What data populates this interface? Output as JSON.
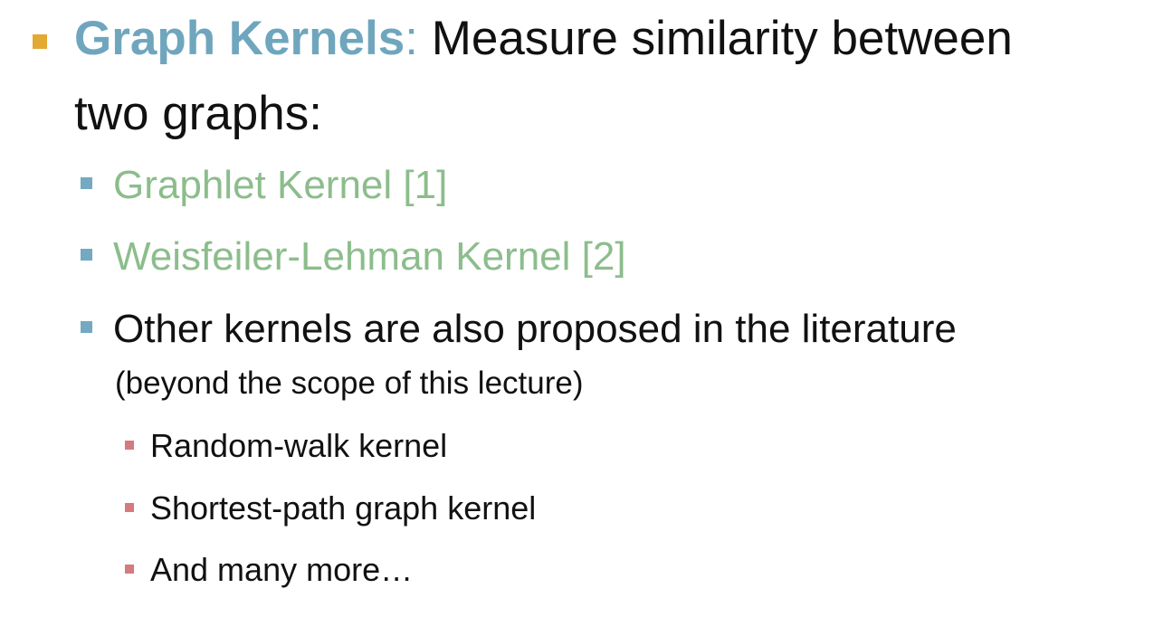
{
  "slide": {
    "bullet1": {
      "term": "Graph Kernels",
      "colon": ":",
      "text_a": " Measure similarity between",
      "text_b": "two graphs:"
    },
    "subbullets": [
      {
        "label": "Graphlet Kernel [1]"
      },
      {
        "label": "Weisfeiler-Lehman Kernel [2]"
      },
      {
        "label": "Other kernels are also proposed in the literature",
        "note": "(beyond the scope of this lecture)"
      }
    ],
    "subsubbullets": [
      {
        "label": "Random-walk kernel"
      },
      {
        "label": "Shortest-path graph kernel"
      },
      {
        "label": "And many more…"
      }
    ]
  }
}
